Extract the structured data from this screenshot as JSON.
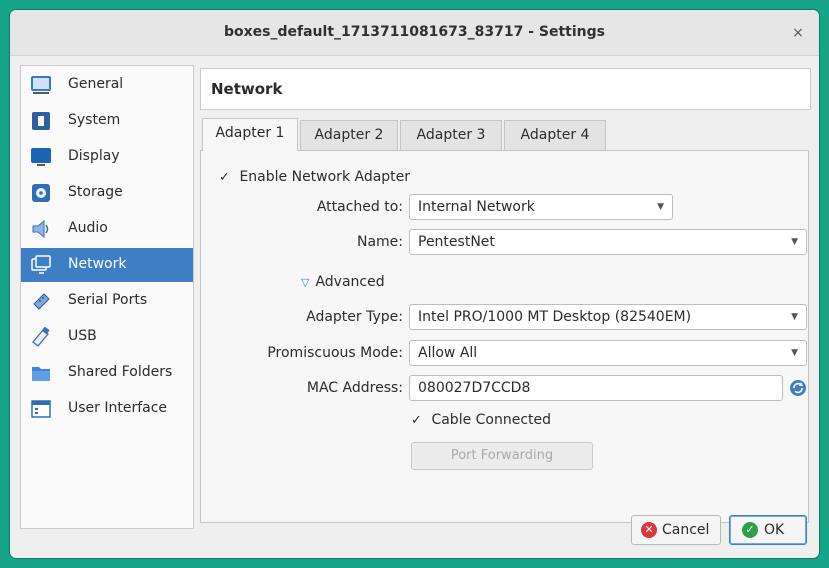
{
  "window": {
    "title": "boxes_default_1713711081673_83717 - Settings",
    "close_glyph": "×"
  },
  "sidebar": {
    "items": [
      {
        "label": "General",
        "icon": "general-icon"
      },
      {
        "label": "System",
        "icon": "system-icon"
      },
      {
        "label": "Display",
        "icon": "display-icon"
      },
      {
        "label": "Storage",
        "icon": "storage-icon"
      },
      {
        "label": "Audio",
        "icon": "audio-icon"
      },
      {
        "label": "Network",
        "icon": "network-icon",
        "active": true
      },
      {
        "label": "Serial Ports",
        "icon": "serial-ports-icon"
      },
      {
        "label": "USB",
        "icon": "usb-icon"
      },
      {
        "label": "Shared Folders",
        "icon": "shared-folders-icon"
      },
      {
        "label": "User Interface",
        "icon": "user-interface-icon"
      }
    ]
  },
  "page": {
    "header": "Network"
  },
  "tabs": [
    {
      "label": "Adapter 1",
      "active": true
    },
    {
      "label": "Adapter 2"
    },
    {
      "label": "Adapter 3"
    },
    {
      "label": "Adapter 4"
    }
  ],
  "adapter": {
    "enable_label": "Enable Network Adapter",
    "enable_checked": true,
    "check_glyph": "✓",
    "attached_label": "Attached to:",
    "attached_value": "Internal Network",
    "name_label": "Name:",
    "name_value": "PentestNet",
    "advanced_label": "Advanced",
    "adapter_type_label": "Adapter Type:",
    "adapter_type_value": "Intel PRO/1000 MT Desktop (82540EM)",
    "promiscuous_label": "Promiscuous Mode:",
    "promiscuous_value": "Allow All",
    "mac_label": "MAC Address:",
    "mac_value": "080027D7CCD8",
    "cable_label": "Cable Connected",
    "cable_checked": true,
    "port_forwarding_label": "Port Forwarding"
  },
  "buttons": {
    "cancel": "Cancel",
    "ok": "OK"
  },
  "colors": {
    "accent": "#3d7ec4",
    "cancel_icon": "#d9363e",
    "ok_icon": "#2e9e4a",
    "background": "#17a589"
  }
}
